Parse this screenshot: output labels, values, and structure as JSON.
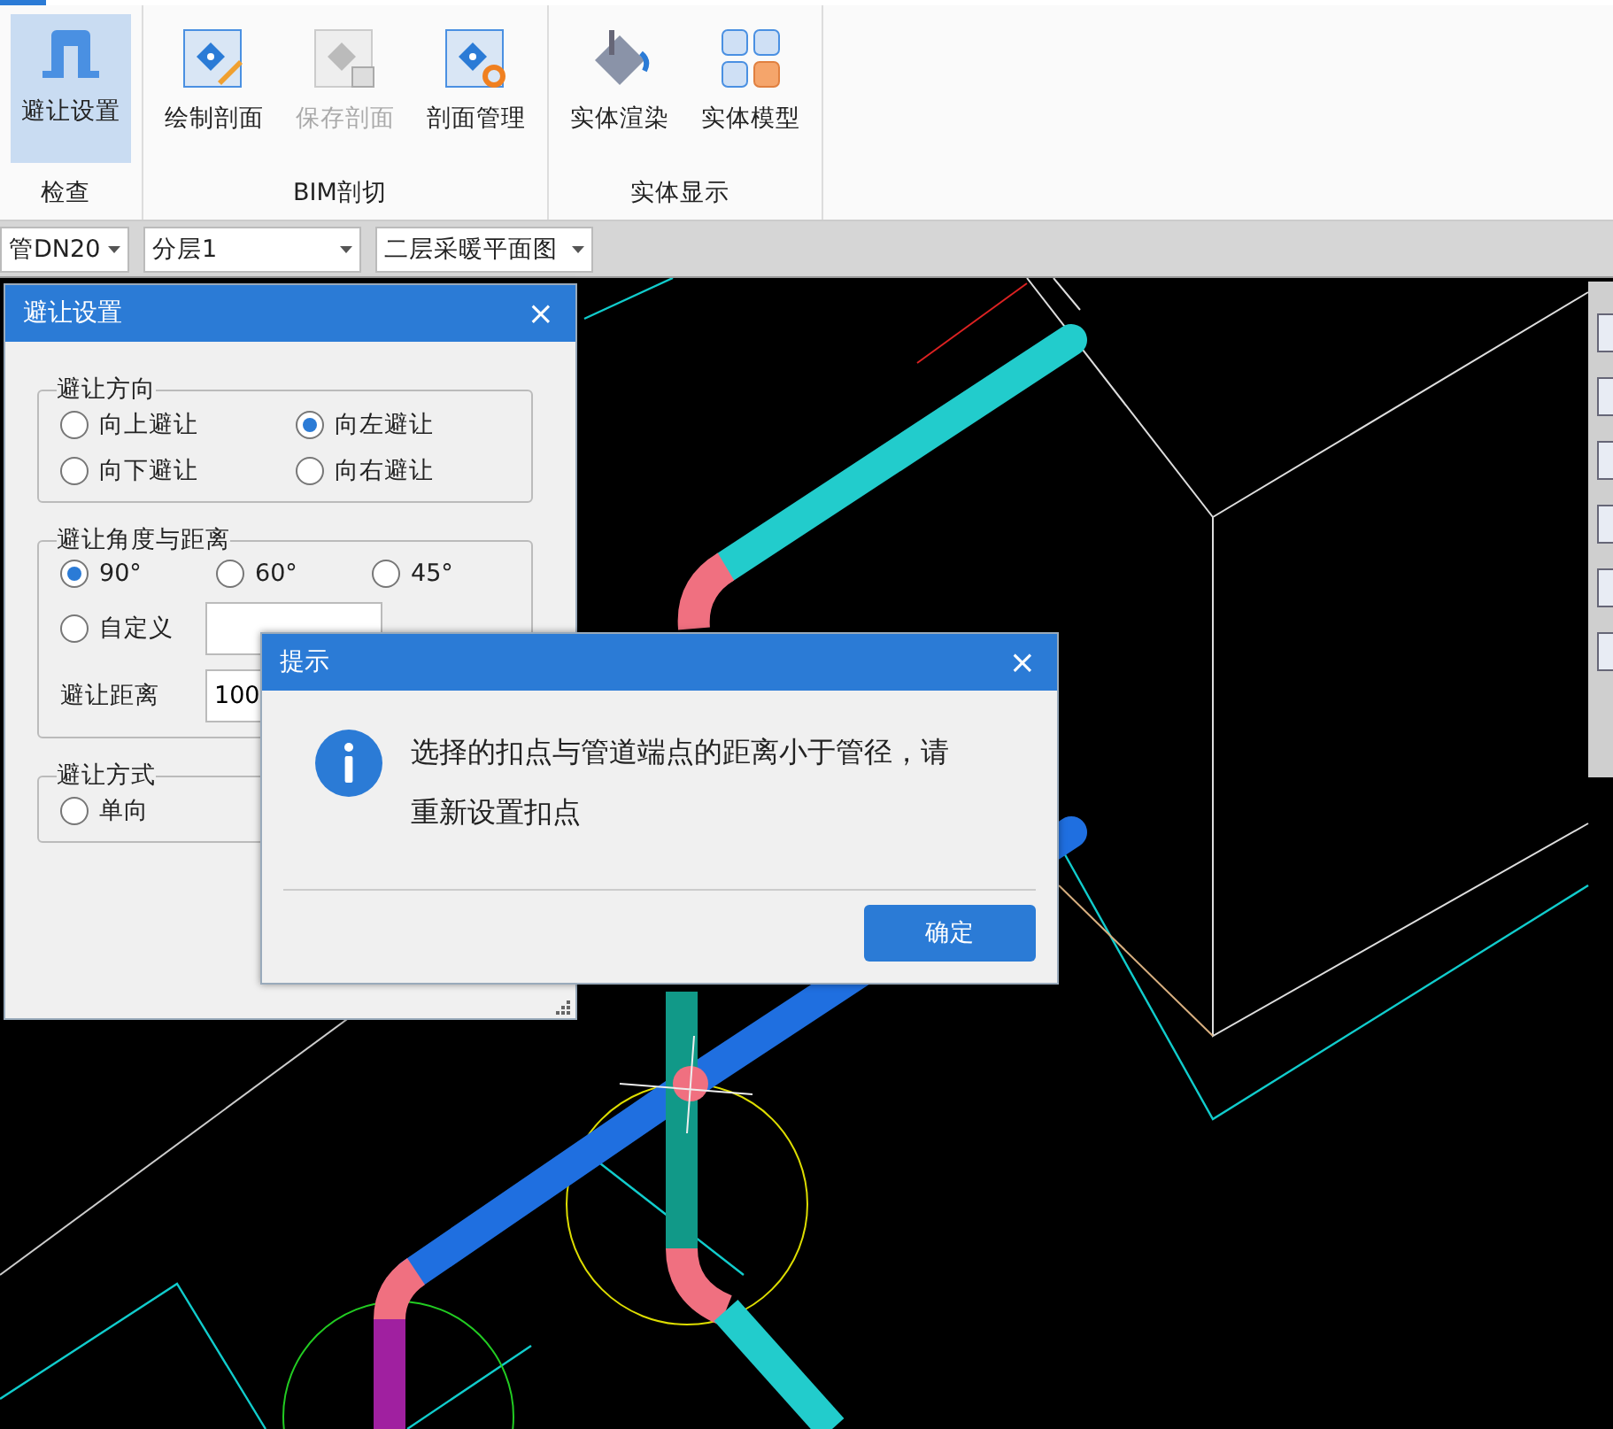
{
  "ribbon": {
    "groups": [
      {
        "label": "检查",
        "buttons": [
          {
            "label": "避让设置",
            "kind": "avoid",
            "selected": true,
            "disabled": false
          }
        ]
      },
      {
        "label": "BIM剖切",
        "buttons": [
          {
            "label": "绘制剖面",
            "kind": "draw",
            "selected": false,
            "disabled": false
          },
          {
            "label": "保存剖面",
            "kind": "save",
            "selected": false,
            "disabled": true
          },
          {
            "label": "剖面管理",
            "kind": "manage",
            "selected": false,
            "disabled": false
          }
        ]
      },
      {
        "label": "实体显示",
        "buttons": [
          {
            "label": "实体渲染",
            "kind": "render",
            "selected": false,
            "disabled": false
          },
          {
            "label": "实体模型",
            "kind": "model",
            "selected": false,
            "disabled": false
          }
        ]
      }
    ]
  },
  "combos": [
    {
      "value": "管DN20"
    },
    {
      "value": "分层1"
    },
    {
      "value": "二层采暖平面图"
    }
  ],
  "avoid_dialog": {
    "title": "避让设置",
    "close": "×",
    "direction": {
      "label": "避让方向",
      "options": [
        {
          "label": "向上避让",
          "selected": false
        },
        {
          "label": "向左避让",
          "selected": true
        },
        {
          "label": "向下避让",
          "selected": false
        },
        {
          "label": "向右避让",
          "selected": false
        }
      ]
    },
    "angle": {
      "label": "避让角度与距离",
      "options": [
        {
          "label": "90°",
          "selected": true
        },
        {
          "label": "60°",
          "selected": false
        },
        {
          "label": "45°",
          "selected": false
        }
      ],
      "custom": {
        "label": "自定义",
        "selected": false
      },
      "distance_label": "避让距离",
      "distance_value": "100"
    },
    "method": {
      "label": "避让方式",
      "options": [
        {
          "label": "单向",
          "selected": false
        }
      ]
    }
  },
  "alert": {
    "title": "提示",
    "close": "×",
    "message": "选择的扣点与管道端点的距离小于管径，请重新设置扣点",
    "button": "确定"
  }
}
